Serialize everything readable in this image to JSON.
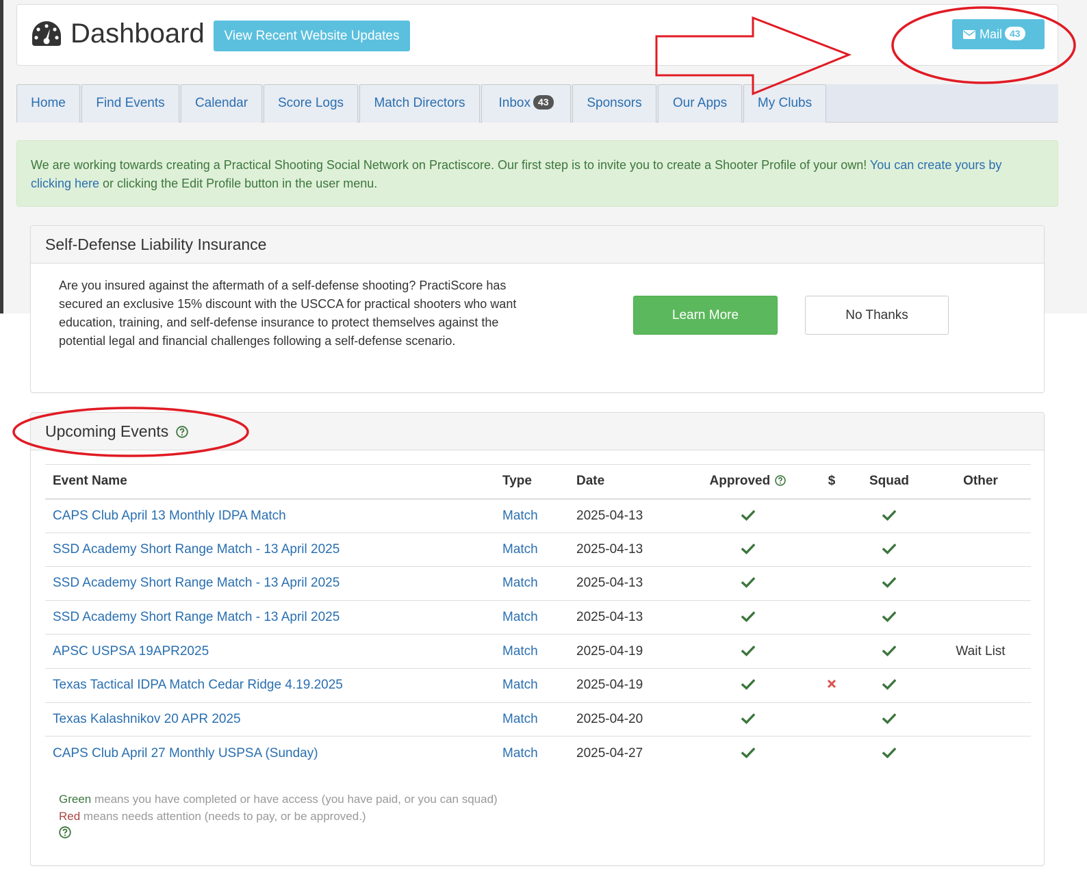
{
  "header": {
    "title": "Dashboard",
    "updates_button": "View Recent Website Updates",
    "mail_label": "Mail",
    "mail_count": "43"
  },
  "tabs": [
    {
      "label": "Home"
    },
    {
      "label": "Find Events"
    },
    {
      "label": "Calendar"
    },
    {
      "label": "Score Logs"
    },
    {
      "label": "Match Directors"
    },
    {
      "label": "Inbox",
      "badge": "43"
    },
    {
      "label": "Sponsors"
    },
    {
      "label": "Our Apps"
    },
    {
      "label": "My Clubs"
    }
  ],
  "alert": {
    "text": "We are working towards creating a Practical Shooting Social Network on Practiscore. Our first step is to invite you to create a Shooter Profile of your own! ",
    "link": "You can create yours by clicking here",
    "text_after": " or clicking the Edit Profile button in the user menu."
  },
  "insurance": {
    "title": "Self-Defense Liability Insurance",
    "body": "Are you insured against the aftermath of a self-defense shooting? PractiScore has secured an exclusive 15% discount with the USCCA for practical shooters who want education, training, and self-defense insurance to protect themselves against the potential legal and financial challenges following a self-defense scenario.",
    "learn_more": "Learn More",
    "no_thanks": "No Thanks"
  },
  "events": {
    "title": "Upcoming Events",
    "columns": {
      "name": "Event Name",
      "type": "Type",
      "date": "Date",
      "approved": "Approved",
      "paid": "$",
      "squad": "Squad",
      "other": "Other"
    },
    "rows": [
      {
        "name": "CAPS Club April 13 Monthly IDPA Match",
        "type": "Match",
        "date": "2025-04-13",
        "approved": "yes",
        "paid": "",
        "squad": "yes",
        "other": ""
      },
      {
        "name": "SSD Academy Short Range Match - 13 April 2025",
        "type": "Match",
        "date": "2025-04-13",
        "approved": "yes",
        "paid": "",
        "squad": "yes",
        "other": ""
      },
      {
        "name": "SSD Academy Short Range Match - 13 April 2025",
        "type": "Match",
        "date": "2025-04-13",
        "approved": "yes",
        "paid": "",
        "squad": "yes",
        "other": ""
      },
      {
        "name": "SSD Academy Short Range Match - 13 April 2025",
        "type": "Match",
        "date": "2025-04-13",
        "approved": "yes",
        "paid": "",
        "squad": "yes",
        "other": ""
      },
      {
        "name": "APSC USPSA 19APR2025",
        "type": "Match",
        "date": "2025-04-19",
        "approved": "yes",
        "paid": "",
        "squad": "yes",
        "other": "Wait List"
      },
      {
        "name": "Texas Tactical IDPA Match Cedar Ridge 4.19.2025",
        "type": "Match",
        "date": "2025-04-19",
        "approved": "yes",
        "paid": "no",
        "squad": "yes",
        "other": ""
      },
      {
        "name": "Texas Kalashnikov 20 APR 2025",
        "type": "Match",
        "date": "2025-04-20",
        "approved": "yes",
        "paid": "",
        "squad": "yes",
        "other": ""
      },
      {
        "name": "CAPS Club April 27 Monthly USPSA (Sunday)",
        "type": "Match",
        "date": "2025-04-27",
        "approved": "yes",
        "paid": "",
        "squad": "yes",
        "other": ""
      }
    ],
    "legend": {
      "green_word": "Green",
      "green_text": " means you have completed or have access (you have paid, or you can squad)",
      "red_word": "Red",
      "red_text": " means needs attention (needs to pay, or be approved.)"
    }
  },
  "colors": {
    "info_button": "#5bc0de",
    "success_button": "#5cb85c",
    "link": "#2a6fb0",
    "check": "#3c763d",
    "cross": "#d9534f",
    "annotation": "#e01b24"
  },
  "icons": [
    "dashboard-gauge-icon",
    "envelope-icon",
    "question-circle-icon",
    "check-icon",
    "cross-icon"
  ]
}
